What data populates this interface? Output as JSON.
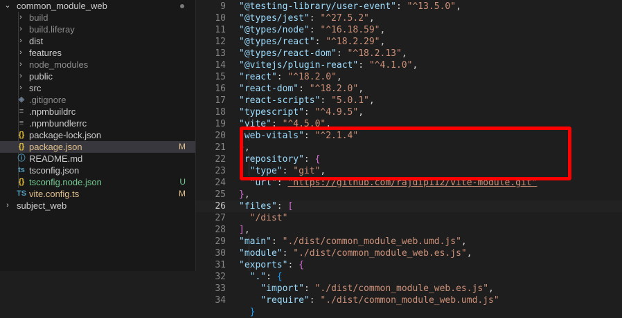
{
  "explorer": {
    "root_label": "common_module_web",
    "items": [
      {
        "label": "build",
        "kind": "folder",
        "color": "#8c8c8c",
        "status": ""
      },
      {
        "label": "build.liferay",
        "kind": "folder",
        "color": "#8c8c8c",
        "status": ""
      },
      {
        "label": "dist",
        "kind": "folder",
        "color": "#cccccc",
        "status": ""
      },
      {
        "label": "features",
        "kind": "folder",
        "color": "#cccccc",
        "status": ""
      },
      {
        "label": "node_modules",
        "kind": "folder",
        "color": "#8c8c8c",
        "status": ""
      },
      {
        "label": "public",
        "kind": "folder",
        "color": "#cccccc",
        "status": ""
      },
      {
        "label": "src",
        "kind": "folder",
        "color": "#cccccc",
        "status": ""
      },
      {
        "label": ".gitignore",
        "kind": "file",
        "icon": "git-icon",
        "glyph": "◈",
        "icon_color": "#6a7c8f",
        "color": "#8c8c8c",
        "status": ""
      },
      {
        "label": ".npmbuildrc",
        "kind": "file",
        "icon": "lines-icon",
        "glyph": "≡",
        "icon_color": "#8c8c8c",
        "color": "#cccccc",
        "status": ""
      },
      {
        "label": ".npmbundlerrc",
        "kind": "file",
        "icon": "lines-icon",
        "glyph": "≡",
        "icon_color": "#8c8c8c",
        "color": "#cccccc",
        "status": ""
      },
      {
        "label": "package-lock.json",
        "kind": "file",
        "icon": "json-icon",
        "glyph": "{}",
        "icon_color": "#e8c03b",
        "color": "#cccccc",
        "status": ""
      },
      {
        "label": "package.json",
        "kind": "file",
        "icon": "json-icon",
        "glyph": "{}",
        "icon_color": "#e8c03b",
        "color": "#e2c08d",
        "status": "M",
        "status_color": "#e2c08d",
        "selected": true
      },
      {
        "label": "README.md",
        "kind": "file",
        "icon": "info-icon",
        "glyph": "ⓘ",
        "icon_color": "#519aba",
        "color": "#cccccc",
        "status": ""
      },
      {
        "label": "tsconfig.json",
        "kind": "file",
        "icon": "ts-icon",
        "glyph": "ts",
        "icon_color": "#519aba",
        "color": "#cccccc",
        "status": ""
      },
      {
        "label": "tsconfig.node.json",
        "kind": "file",
        "icon": "json-icon",
        "glyph": "{}",
        "icon_color": "#e8c03b",
        "color": "#73c991",
        "status": "U",
        "status_color": "#73c991"
      },
      {
        "label": "vite.config.ts",
        "kind": "file",
        "icon": "ts-icon",
        "glyph": "TS",
        "icon_color": "#519aba",
        "color": "#e2c08d",
        "status": "M",
        "status_color": "#e2c08d"
      }
    ],
    "sibling": {
      "label": "subject_web"
    }
  },
  "editor": {
    "active_line": 26,
    "lines": [
      {
        "n": "9",
        "tokens": [
          [
            "k",
            "\"@testing-library/user-event\""
          ],
          [
            "p",
            ": "
          ],
          [
            "s",
            "\"^13.5.0\""
          ],
          [
            "p",
            ","
          ]
        ]
      },
      {
        "n": "10",
        "tokens": [
          [
            "k",
            "\"@types/jest\""
          ],
          [
            "p",
            ": "
          ],
          [
            "s",
            "\"^27.5.2\""
          ],
          [
            "p",
            ","
          ]
        ]
      },
      {
        "n": "11",
        "tokens": [
          [
            "k",
            "\"@types/node\""
          ],
          [
            "p",
            ": "
          ],
          [
            "s",
            "\"^16.18.59\""
          ],
          [
            "p",
            ","
          ]
        ]
      },
      {
        "n": "12",
        "tokens": [
          [
            "k",
            "\"@types/react\""
          ],
          [
            "p",
            ": "
          ],
          [
            "s",
            "\"^18.2.29\""
          ],
          [
            "p",
            ","
          ]
        ]
      },
      {
        "n": "13",
        "tokens": [
          [
            "k",
            "\"@types/react-dom\""
          ],
          [
            "p",
            ": "
          ],
          [
            "s",
            "\"^18.2.13\""
          ],
          [
            "p",
            ","
          ]
        ]
      },
      {
        "n": "14",
        "tokens": [
          [
            "k",
            "\"@vitejs/plugin-react\""
          ],
          [
            "p",
            ": "
          ],
          [
            "s",
            "\"^4.1.0\""
          ],
          [
            "p",
            ","
          ]
        ]
      },
      {
        "n": "15",
        "tokens": [
          [
            "k",
            "\"react\""
          ],
          [
            "p",
            ": "
          ],
          [
            "s",
            "\"^18.2.0\""
          ],
          [
            "p",
            ","
          ]
        ]
      },
      {
        "n": "16",
        "tokens": [
          [
            "k",
            "\"react-dom\""
          ],
          [
            "p",
            ": "
          ],
          [
            "s",
            "\"^18.2.0\""
          ],
          [
            "p",
            ","
          ]
        ]
      },
      {
        "n": "17",
        "tokens": [
          [
            "k",
            "\"react-scripts\""
          ],
          [
            "p",
            ": "
          ],
          [
            "s",
            "\"5.0.1\""
          ],
          [
            "p",
            ","
          ]
        ]
      },
      {
        "n": "18",
        "tokens": [
          [
            "k",
            "\"typescript\""
          ],
          [
            "p",
            ": "
          ],
          [
            "s",
            "\"^4.9.5\""
          ],
          [
            "p",
            ","
          ]
        ]
      },
      {
        "n": "19",
        "tokens": [
          [
            "k",
            "\"vite\""
          ],
          [
            "p",
            ": "
          ],
          [
            "s",
            "\"^4.5.0\""
          ],
          [
            "p",
            ","
          ]
        ]
      },
      {
        "n": "20",
        "tokens": [
          [
            "k",
            "\"web-vitals\""
          ],
          [
            "p",
            ": "
          ],
          [
            "s",
            "\"^2.1.4\""
          ]
        ]
      },
      {
        "n": "21",
        "tokens": [
          [
            "b2",
            "}"
          ],
          [
            "p",
            ","
          ]
        ]
      },
      {
        "n": "22",
        "tokens": [
          [
            "k",
            "\"repository\""
          ],
          [
            "p",
            ": "
          ],
          [
            "b2",
            "{"
          ]
        ]
      },
      {
        "n": "23",
        "tokens": [
          [
            "p",
            "  "
          ],
          [
            "k",
            "\"type\""
          ],
          [
            "p",
            ": "
          ],
          [
            "s",
            "\"git\""
          ],
          [
            "p",
            ","
          ]
        ]
      },
      {
        "n": "24",
        "tokens": [
          [
            "p",
            "  "
          ],
          [
            "k",
            "\"url\""
          ],
          [
            "p",
            ": "
          ],
          [
            "url",
            "\"https://github.com/rajdip112/vite-module.git\""
          ]
        ]
      },
      {
        "n": "25",
        "tokens": [
          [
            "b2",
            "}"
          ],
          [
            "p",
            ","
          ]
        ]
      },
      {
        "n": "26",
        "tokens": [
          [
            "k",
            "\"files\""
          ],
          [
            "p",
            ": "
          ],
          [
            "b2",
            "["
          ]
        ]
      },
      {
        "n": "27",
        "tokens": [
          [
            "p",
            "  "
          ],
          [
            "s",
            "\"/dist\""
          ]
        ]
      },
      {
        "n": "28",
        "tokens": [
          [
            "b2",
            "]"
          ],
          [
            "p",
            ","
          ]
        ]
      },
      {
        "n": "29",
        "tokens": [
          [
            "k",
            "\"main\""
          ],
          [
            "p",
            ": "
          ],
          [
            "s",
            "\"./dist/common_module_web.umd.js\""
          ],
          [
            "p",
            ","
          ]
        ]
      },
      {
        "n": "30",
        "tokens": [
          [
            "k",
            "\"module\""
          ],
          [
            "p",
            ": "
          ],
          [
            "s",
            "\"./dist/common_module_web.es.js\""
          ],
          [
            "p",
            ","
          ]
        ]
      },
      {
        "n": "31",
        "tokens": [
          [
            "k",
            "\"exports\""
          ],
          [
            "p",
            ": "
          ],
          [
            "b2",
            "{"
          ]
        ]
      },
      {
        "n": "32",
        "tokens": [
          [
            "p",
            "  "
          ],
          [
            "k",
            "\".\""
          ],
          [
            "p",
            ": "
          ],
          [
            "b3",
            "{"
          ]
        ]
      },
      {
        "n": "33",
        "tokens": [
          [
            "p",
            "    "
          ],
          [
            "k",
            "\"import\""
          ],
          [
            "p",
            ": "
          ],
          [
            "s",
            "\"./dist/common_module_web.es.js\""
          ],
          [
            "p",
            ","
          ]
        ]
      },
      {
        "n": "34",
        "tokens": [
          [
            "p",
            "    "
          ],
          [
            "k",
            "\"require\""
          ],
          [
            "p",
            ": "
          ],
          [
            "s",
            "\"./dist/common_module_web.umd.js\""
          ]
        ]
      },
      {
        "n": "",
        "tokens": [
          [
            "p",
            "  "
          ],
          [
            "b3",
            "}"
          ]
        ]
      }
    ]
  },
  "annotation": {
    "color": "#ff0000"
  }
}
